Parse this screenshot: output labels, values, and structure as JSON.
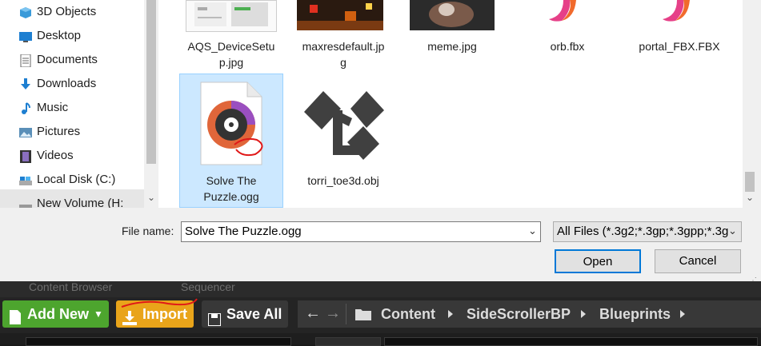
{
  "nav_pane": {
    "items": [
      {
        "label": "3D Objects",
        "icon": "3d-objects-icon"
      },
      {
        "label": "Desktop",
        "icon": "desktop-icon"
      },
      {
        "label": "Documents",
        "icon": "documents-icon"
      },
      {
        "label": "Downloads",
        "icon": "downloads-icon"
      },
      {
        "label": "Music",
        "icon": "music-icon"
      },
      {
        "label": "Pictures",
        "icon": "pictures-icon"
      },
      {
        "label": "Videos",
        "icon": "videos-icon"
      },
      {
        "label": "Local Disk (C:)",
        "icon": "local-disk-icon"
      },
      {
        "label": "New Volume (H:",
        "icon": "new-volume-icon"
      }
    ]
  },
  "files": [
    {
      "name": "AQS_DeviceSetu\np.jpg"
    },
    {
      "name": "maxresdefault.jp\ng"
    },
    {
      "name": "meme.jpg"
    },
    {
      "name": "orb.fbx"
    },
    {
      "name": "portal_FBX.FBX"
    },
    {
      "name": "Solve The\nPuzzle.ogg"
    },
    {
      "name": "torri_toe3d.obj"
    }
  ],
  "footer": {
    "filename_label": "File name:",
    "filename_value": "Solve The Puzzle.ogg",
    "filter_value": "All Files (*.3g2;*.3gp;*.3gpp;*.3g",
    "open_label": "Open",
    "cancel_label": "Cancel"
  },
  "editor": {
    "tabs": [
      "Content Browser",
      "Sequencer"
    ],
    "add_new_label": "Add New",
    "import_label": "Import",
    "save_all_label": "Save All",
    "breadcrumbs": [
      "Content",
      "SideScrollerBP",
      "Blueprints"
    ],
    "colors": {
      "add_new": "#4da52e",
      "import": "#e9a41a"
    }
  }
}
